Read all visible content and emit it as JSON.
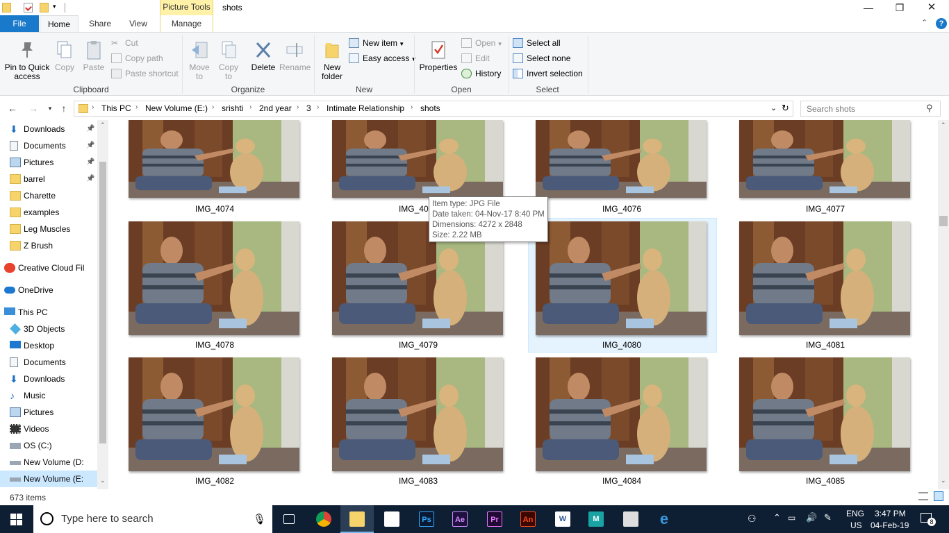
{
  "window": {
    "title": "shots",
    "context_tab_header": "Picture Tools",
    "buttons": {
      "minimize": "—",
      "restore": "❐",
      "close": "✕"
    }
  },
  "tabs": {
    "file": "File",
    "home": "Home",
    "share": "Share",
    "view": "View",
    "manage": "Manage"
  },
  "ribbon": {
    "clipboard": {
      "group": "Clipboard",
      "pin": "Pin to Quick access",
      "copy": "Copy",
      "paste": "Paste",
      "cut": "Cut",
      "copy_path": "Copy path",
      "paste_shortcut": "Paste shortcut"
    },
    "organize": {
      "group": "Organize",
      "move_to": "Move to",
      "copy_to": "Copy to",
      "delete": "Delete",
      "rename": "Rename"
    },
    "new": {
      "group": "New",
      "new_folder": "New folder",
      "new_item": "New item",
      "easy_access": "Easy access"
    },
    "open": {
      "group": "Open",
      "properties": "Properties",
      "open": "Open",
      "edit": "Edit",
      "history": "History"
    },
    "select": {
      "group": "Select",
      "select_all": "Select all",
      "select_none": "Select none",
      "invert": "Invert selection"
    }
  },
  "address": {
    "crumbs": [
      "This PC",
      "New Volume (E:)",
      "srishti",
      "2nd year",
      "3",
      "Intimate Relationship",
      "shots"
    ],
    "search_placeholder": "Search shots"
  },
  "nav": {
    "items": [
      {
        "label": "Downloads",
        "icon": "download-arrow-icon",
        "pinned": true
      },
      {
        "label": "Documents",
        "icon": "document-icon",
        "pinned": true
      },
      {
        "label": "Pictures",
        "icon": "pictures-icon",
        "pinned": true
      },
      {
        "label": "barrel",
        "icon": "folder-icon",
        "pinned": true
      },
      {
        "label": "Charette",
        "icon": "folder-icon",
        "pinned": false
      },
      {
        "label": "examples",
        "icon": "folder-icon",
        "pinned": false
      },
      {
        "label": "Leg Muscles",
        "icon": "folder-icon",
        "pinned": false
      },
      {
        "label": "Z Brush",
        "icon": "folder-icon",
        "pinned": false
      },
      {
        "label": "Creative Cloud Fil",
        "icon": "creative-cloud-icon",
        "pinned": false
      },
      {
        "label": "OneDrive",
        "icon": "cloud-icon",
        "pinned": false
      },
      {
        "label": "This PC",
        "icon": "computer-icon",
        "pinned": false
      },
      {
        "label": "3D Objects",
        "icon": "cube-icon",
        "pinned": false
      },
      {
        "label": "Desktop",
        "icon": "desktop-icon",
        "pinned": false
      },
      {
        "label": "Documents",
        "icon": "document-icon",
        "pinned": false
      },
      {
        "label": "Downloads",
        "icon": "download-arrow-icon",
        "pinned": false
      },
      {
        "label": "Music",
        "icon": "music-note-icon",
        "pinned": false
      },
      {
        "label": "Pictures",
        "icon": "pictures-icon",
        "pinned": false
      },
      {
        "label": "Videos",
        "icon": "film-icon",
        "pinned": false
      },
      {
        "label": "OS (C:)",
        "icon": "windows-drive-icon",
        "pinned": false
      },
      {
        "label": "New Volume (D:",
        "icon": "drive-icon",
        "pinned": false
      },
      {
        "label": "New Volume (E:",
        "icon": "drive-icon",
        "pinned": false
      }
    ]
  },
  "files": [
    "IMG_4074",
    "IMG_4075",
    "IMG_4076",
    "IMG_4077",
    "IMG_4078",
    "IMG_4079",
    "IMG_4080",
    "IMG_4081",
    "IMG_4082",
    "IMG_4083",
    "IMG_4084",
    "IMG_4085"
  ],
  "tooltip": {
    "type": "Item type: JPG File",
    "date": "Date taken: 04-Nov-17 8:40 PM",
    "dimensions": "Dimensions: 4272 x 2848",
    "size": "Size: 2.22 MB"
  },
  "status": {
    "count": "673 items"
  },
  "taskbar": {
    "search_placeholder": "Type here to search",
    "apps": [
      {
        "name": "task-view",
        "label": ""
      },
      {
        "name": "chrome",
        "label": ""
      },
      {
        "name": "file-explorer",
        "label": ""
      },
      {
        "name": "store",
        "label": ""
      },
      {
        "name": "photoshop",
        "label": "Ps"
      },
      {
        "name": "after-effects",
        "label": "Ae"
      },
      {
        "name": "premiere",
        "label": "Pr"
      },
      {
        "name": "animate",
        "label": "An"
      },
      {
        "name": "word",
        "label": "W"
      },
      {
        "name": "maya",
        "label": "M"
      },
      {
        "name": "zbrush",
        "label": ""
      },
      {
        "name": "edge",
        "label": "e"
      }
    ],
    "lang_top": "ENG",
    "lang_bottom": "US",
    "time": "3:47 PM",
    "date": "04-Feb-19",
    "notifications": "8"
  },
  "colors": {
    "accent": "#1979ca",
    "selection": "#e5f3ff",
    "context_tab": "#fff2a8",
    "taskbar": "#0f1f33"
  }
}
